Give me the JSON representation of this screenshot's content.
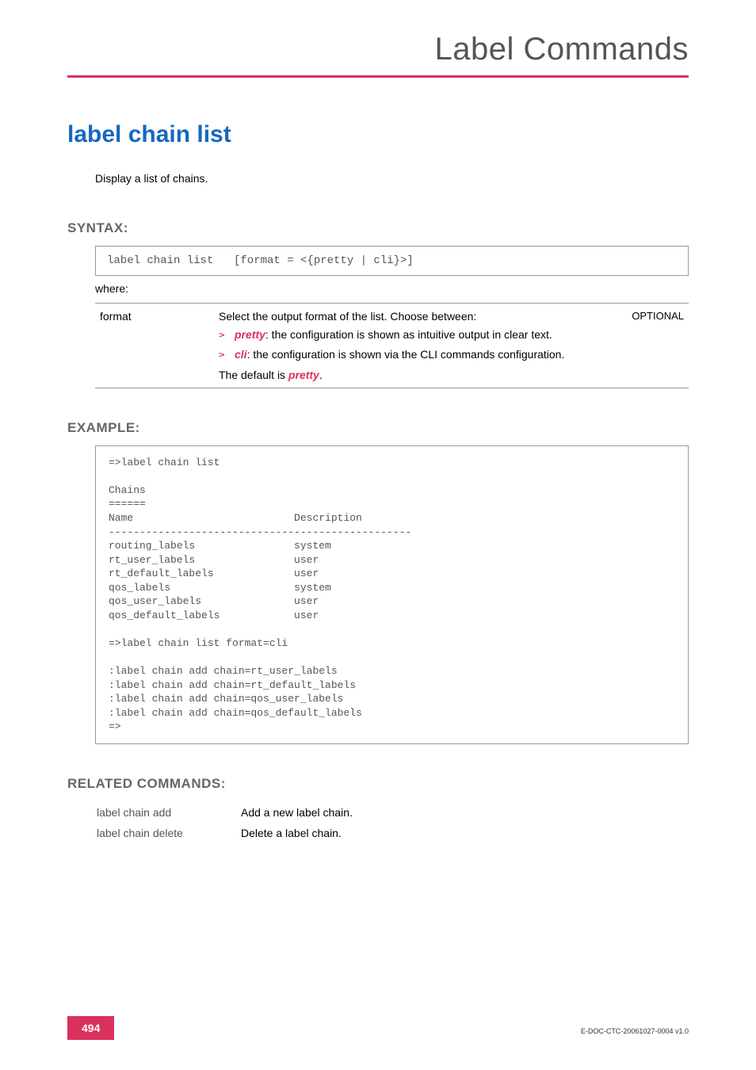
{
  "header": {
    "title": "Label Commands"
  },
  "command": {
    "title": "label chain list",
    "description": "Display a list of chains."
  },
  "syntax": {
    "heading": "SYNTAX:",
    "command": "label chain list",
    "args": "[format = <{pretty | cli}>]",
    "where": "where:"
  },
  "param": {
    "name": "format",
    "intro": "Select the output format of the list. Choose between:",
    "opt1_kw": "pretty",
    "opt1_rest": ": the configuration is shown as intuitive output in clear text.",
    "opt2_kw": "cli",
    "opt2_rest": ": the configuration is shown via the CLI commands configuration.",
    "default_prefix": "The default is ",
    "default_kw": "pretty",
    "default_suffix": ".",
    "optional": "OPTIONAL"
  },
  "example": {
    "heading": "EXAMPLE:",
    "body": "=>label chain list\n\nChains\n======\nName                          Description\n-------------------------------------------------\nrouting_labels                system\nrt_user_labels                user\nrt_default_labels             user\nqos_labels                    system\nqos_user_labels               user\nqos_default_labels            user\n\n=>label chain list format=cli\n\n:label chain add chain=rt_user_labels\n:label chain add chain=rt_default_labels\n:label chain add chain=qos_user_labels\n:label chain add chain=qos_default_labels\n=>"
  },
  "related": {
    "heading": "RELATED COMMANDS:",
    "rows": [
      {
        "cmd": "label chain add",
        "desc": "Add a new label chain."
      },
      {
        "cmd": "label chain delete",
        "desc": "Delete a label chain."
      }
    ]
  },
  "footer": {
    "page": "494",
    "doc_id": "E-DOC-CTC-20061027-0004 v1.0"
  },
  "chart_data": {
    "type": "table",
    "title": "Chains",
    "columns": [
      "Name",
      "Description"
    ],
    "rows": [
      [
        "routing_labels",
        "system"
      ],
      [
        "rt_user_labels",
        "user"
      ],
      [
        "rt_default_labels",
        "user"
      ],
      [
        "qos_labels",
        "system"
      ],
      [
        "qos_user_labels",
        "user"
      ],
      [
        "qos_default_labels",
        "user"
      ]
    ]
  }
}
